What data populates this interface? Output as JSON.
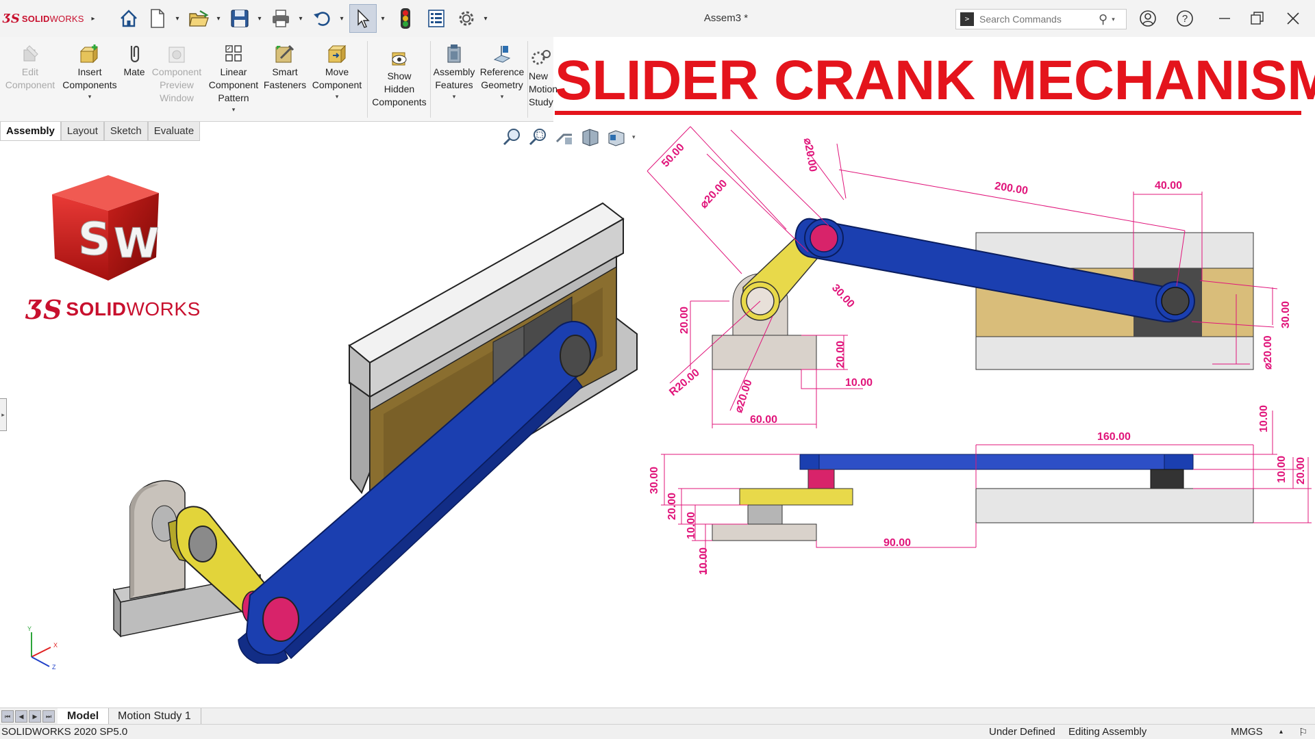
{
  "app": {
    "logo_text_bold": "SOLID",
    "logo_text_light": "WORKS",
    "document_title": "Assem3 *"
  },
  "search": {
    "placeholder": "Search Commands"
  },
  "title_bar_icons": [
    "home-icon",
    "new-document-icon",
    "open-icon",
    "save-icon",
    "print-icon",
    "undo-icon",
    "select-icon",
    "rebuild-icon",
    "file-properties-icon",
    "options-icon"
  ],
  "window_controls": [
    "user-icon",
    "help-icon",
    "minimize-icon",
    "restore-icon",
    "close-icon"
  ],
  "commands": [
    {
      "label": "Edit\nComponent",
      "icon": "edit-component-icon",
      "disabled": true
    },
    {
      "label": "Insert\nComponents",
      "icon": "insert-components-icon",
      "disabled": false
    },
    {
      "label": "Mate",
      "icon": "mate-icon",
      "disabled": false
    },
    {
      "label": "Component\nPreview\nWindow",
      "icon": "component-preview-icon",
      "disabled": true
    },
    {
      "label": "Linear\nComponent\nPattern",
      "icon": "linear-pattern-icon",
      "disabled": false
    },
    {
      "label": "Smart\nFasteners",
      "icon": "smart-fasteners-icon",
      "disabled": false
    },
    {
      "label": "Move\nComponent",
      "icon": "move-component-icon",
      "disabled": false
    },
    {
      "label": "Show\nHidden\nComponents",
      "icon": "show-hidden-icon",
      "disabled": false
    },
    {
      "label": "Assembly\nFeatures",
      "icon": "assembly-features-icon",
      "disabled": false
    },
    {
      "label": "Reference\nGeometry",
      "icon": "reference-geometry-icon",
      "disabled": false
    },
    {
      "label": "New\nMotion\nStudy",
      "icon": "new-motion-study-icon",
      "disabled": false
    }
  ],
  "tabs": [
    "Assembly",
    "Layout",
    "Sketch",
    "Evaluate"
  ],
  "overlay_title": "SLIDER CRANK MECHANISM",
  "brand": {
    "cube_letters": [
      "S",
      "W"
    ],
    "name_bold": "SOLID",
    "name_light": "WORKS"
  },
  "dimensions_front": [
    "50.00",
    "⌀20.00",
    "⌀20.00",
    "200.00",
    "40.00",
    "30.00",
    "20.00",
    "20.00",
    "10.00",
    "R20.00",
    "⌀20.00",
    "60.00",
    "30.00",
    "⌀20.00"
  ],
  "dimensions_bottom": [
    "10.00",
    "160.00",
    "30.00",
    "20.00",
    "10.00",
    "10.00",
    "90.00",
    "10.00",
    "20.00"
  ],
  "triad": {
    "x": "X",
    "y": "Y",
    "z": "Z"
  },
  "bottom_tabs": [
    "Model",
    "Motion Study 1"
  ],
  "status": {
    "version": "SOLIDWORKS 2020 SP5.0",
    "state": "Under Defined",
    "mode": "Editing Assembly",
    "units": "MMGS",
    "arrow": "▴"
  },
  "colors": {
    "brand_red": "#c8102e",
    "title_red": "#e4141c",
    "link_blue": "#2a44b8",
    "crank_yellow": "#e2d43a",
    "slider_tan": "#d6b56a",
    "dim_magenta": "#e0147a",
    "pin_pink": "#d8236a"
  }
}
